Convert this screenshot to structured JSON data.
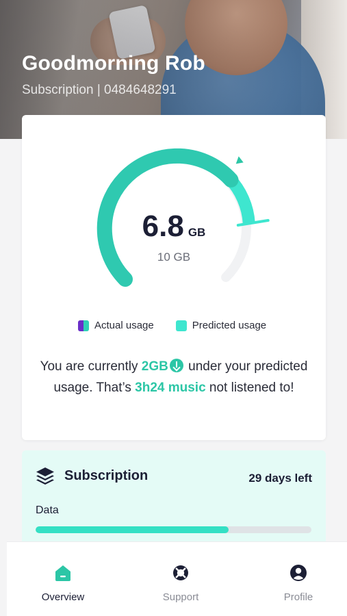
{
  "header": {
    "greeting": "Goodmorning Rob",
    "subline": "Subscription | 0484648291"
  },
  "usage": {
    "value": "6.8",
    "unit": "GB",
    "total": "10 GB",
    "used_fraction": 0.68,
    "predicted_fraction": 0.82,
    "colors": {
      "actual": "#2fc9b0",
      "predicted": "#3ee6cf",
      "track": "#f1f2f4"
    },
    "legend": {
      "actual": "Actual usage",
      "predicted": "Predicted usage"
    },
    "message": {
      "part1": "You are currently ",
      "highlight1": "2GB",
      "part2": " under your predicted usage. That’s ",
      "highlight2": "3h24 music",
      "part3": " not listened to!"
    }
  },
  "subscription": {
    "title": "Subscription",
    "days_left": "29 days left",
    "data_label": "Data",
    "data_fraction": 0.7
  },
  "nav": {
    "items": [
      {
        "label": "Overview",
        "icon": "home-icon",
        "active": true
      },
      {
        "label": "Support",
        "icon": "support-icon",
        "active": false
      },
      {
        "label": "Profile",
        "icon": "profile-icon",
        "active": false
      }
    ]
  },
  "colors": {
    "accent": "#2cc6a6",
    "text": "#1c1f35",
    "subscription_bg": "#e4fbf6"
  }
}
